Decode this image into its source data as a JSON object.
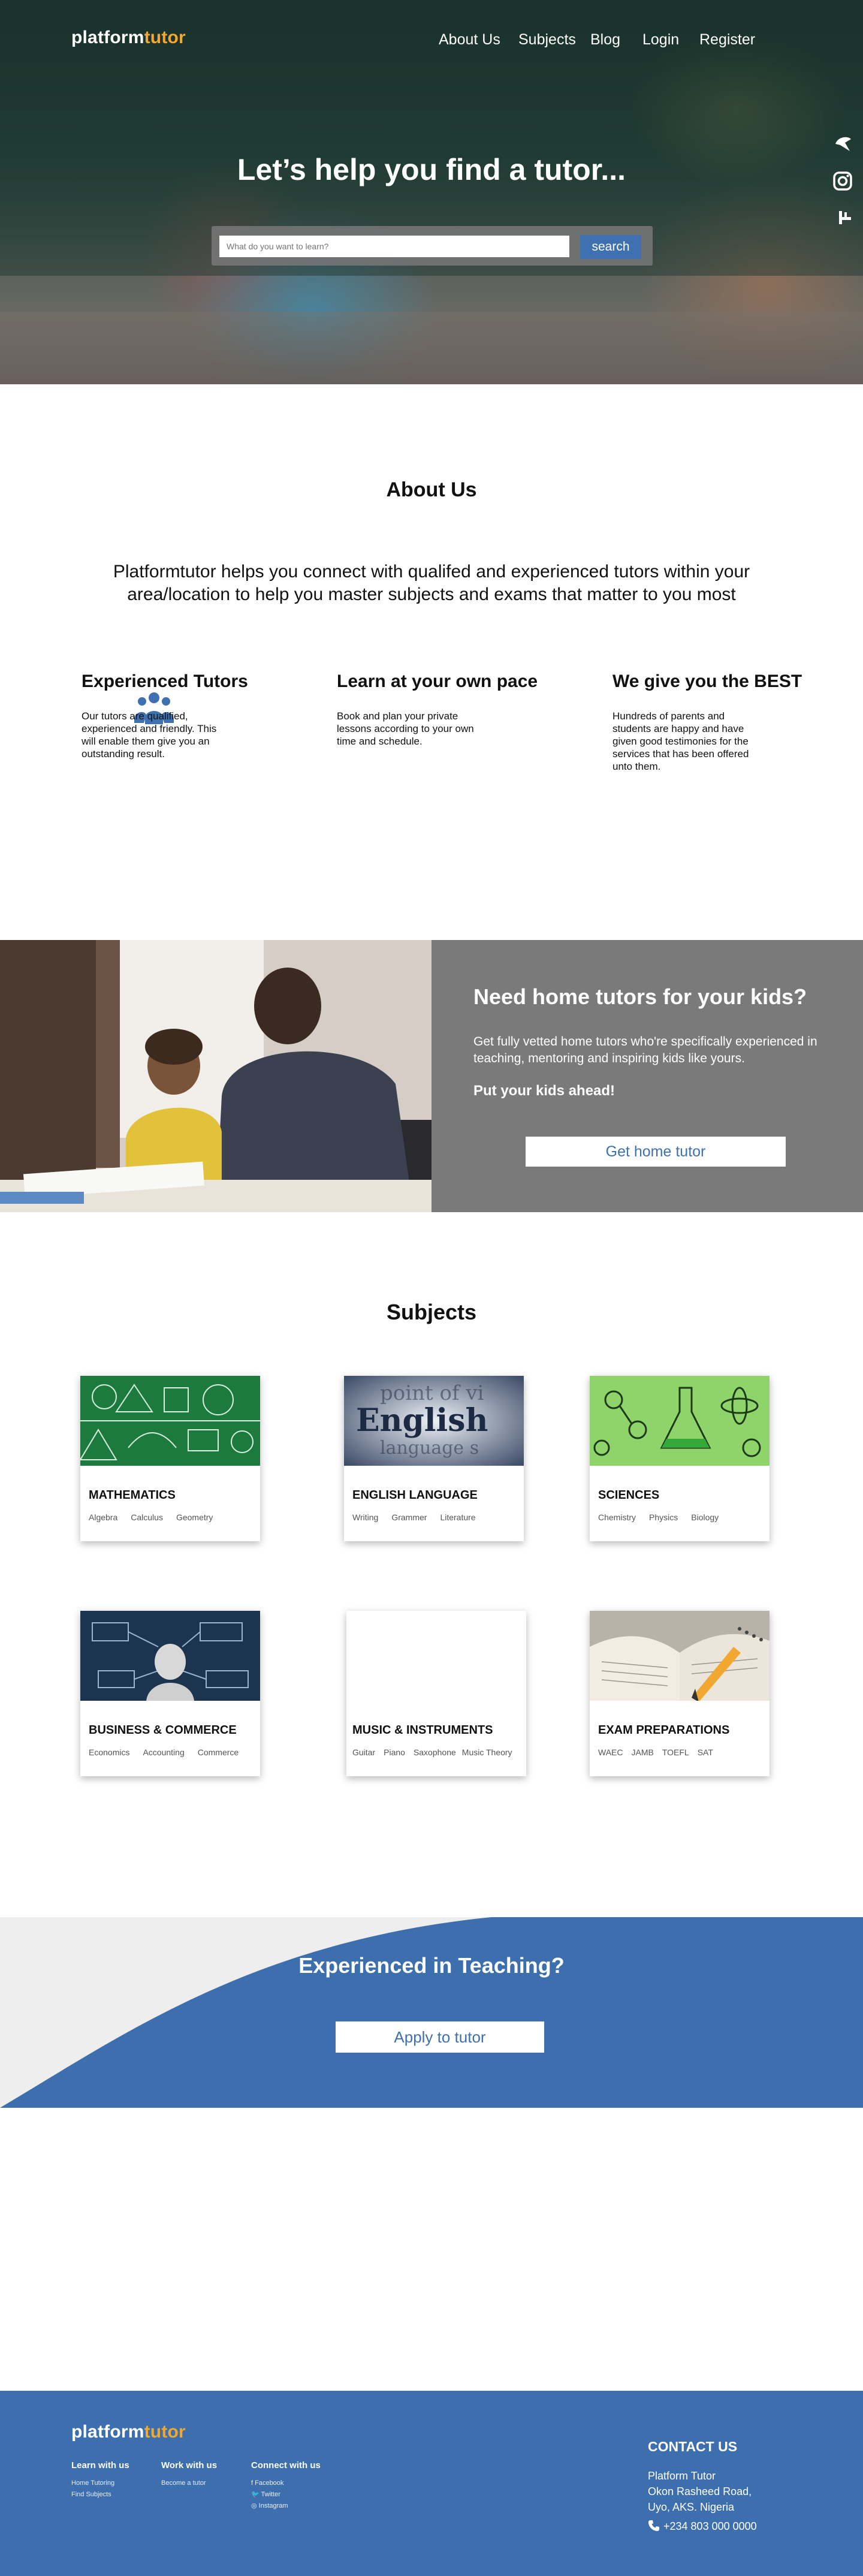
{
  "brand": {
    "name_part1": "platform",
    "name_part2": "tutor",
    "accent_color": "#f0a830",
    "primary_color": "#3d6fae"
  },
  "nav": [
    "About Us",
    "Subjects",
    "Blog",
    "Login",
    "Register"
  ],
  "side_social": [
    "thumbtack-icon",
    "instagram-icon",
    "facebook-icon"
  ],
  "hero": {
    "title": "Let’s help you find a tutor...",
    "search_placeholder": "What do you want to learn?",
    "search_button": "search"
  },
  "about": {
    "title": "About Us",
    "text": "Platformtutor helps you connect with qualifed and experienced tutors within your area/location to help you master subjects and exams that matter to you most",
    "features": [
      {
        "title": "Experienced Tutors",
        "text": "Our tutors are qualified, experienced and friendly. This will enable them give you an outstanding result."
      },
      {
        "title": "Learn at your own pace",
        "text": "Book and plan your private lessons according to your own time and schedule."
      },
      {
        "title": "We give you the BEST",
        "text": "Hundreds of parents and students are happy and have given good testimonies for the services that has been offered unto them."
      }
    ]
  },
  "kids": {
    "title": "Need home tutors for your kids?",
    "description": "Get fully vetted home tutors who're specifically experienced in teaching, mentoring and inspiring kids like yours.",
    "cta": "Put your kids ahead!",
    "button": "Get home tutor"
  },
  "subjects": {
    "title": "Subjects",
    "cards": [
      {
        "name": "MATHEMATICS",
        "tags": [
          "Algebra",
          "Calculus",
          "Geometry"
        ]
      },
      {
        "name": "ENGLISH LANGUAGE",
        "tags": [
          "Writing",
          "Grammer",
          "Literature"
        ]
      },
      {
        "name": "SCIENCES",
        "tags": [
          "Chemistry",
          "Physics",
          "Biology"
        ]
      },
      {
        "name": "BUSINESS & COMMERCE",
        "tags": [
          "Economics",
          "Accounting",
          "Commerce"
        ]
      },
      {
        "name": "MUSIC & INSTRUMENTS",
        "tags": [
          "Guitar",
          "Piano",
          "Saxophone",
          "Music Theory"
        ]
      },
      {
        "name": "EXAM PREPARATIONS",
        "tags": [
          "WAEC",
          "JAMB",
          "TOEFL",
          "SAT"
        ]
      }
    ]
  },
  "teach": {
    "title": "Experienced in Teaching?",
    "button": "Apply to tutor"
  },
  "footer": {
    "columns": [
      {
        "title": "Learn with us",
        "links": [
          "Home Tutoring",
          "Find Subjects"
        ]
      },
      {
        "title": "Work with us",
        "links": [
          "Become a tutor"
        ]
      },
      {
        "title": "Connect with us",
        "links": [
          "f  Facebook",
          "🐦 Twitter",
          "◎ Instagram"
        ]
      }
    ],
    "contact": {
      "title": "CONTACT US",
      "name": "Platform Tutor",
      "address1": "Okon Rasheed Road,",
      "address2": "Uyo, AKS. Nigeria",
      "phone": "+234 803 000 0000"
    }
  }
}
